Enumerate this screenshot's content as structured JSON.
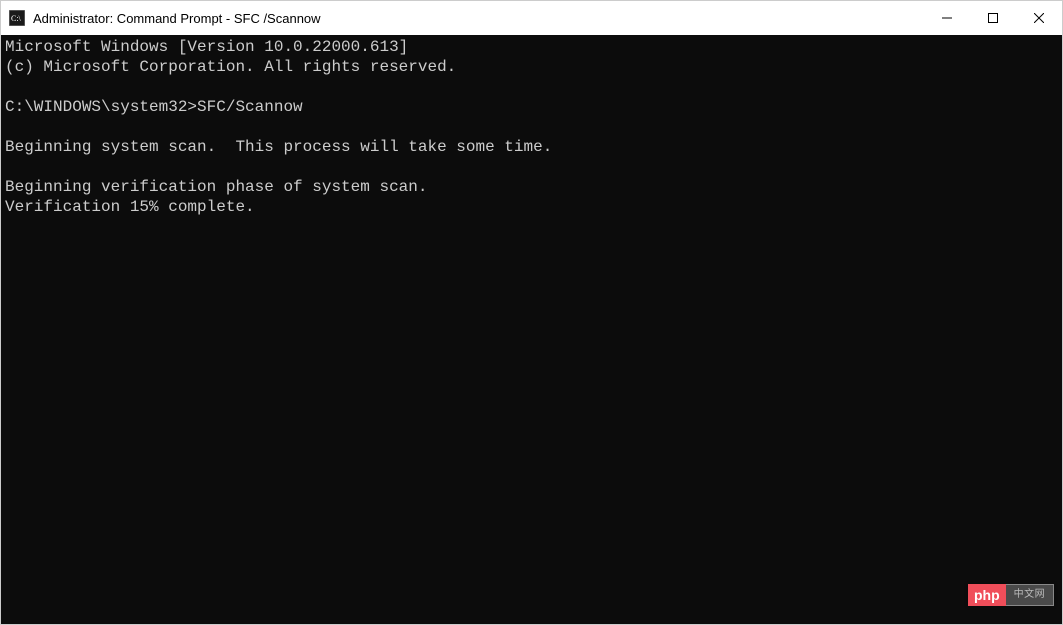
{
  "window": {
    "title": "Administrator: Command Prompt - SFC /Scannow"
  },
  "terminal": {
    "line1": "Microsoft Windows [Version 10.0.22000.613]",
    "line2": "(c) Microsoft Corporation. All rights reserved.",
    "blank1": "",
    "prompt": "C:\\WINDOWS\\system32>",
    "command": "SFC/Scannow",
    "blank2": "",
    "line3": "Beginning system scan.  This process will take some time.",
    "blank3": "",
    "line4": "Beginning verification phase of system scan.",
    "line5": "Verification 15% complete."
  },
  "watermark": {
    "left": "php",
    "right": "中文网"
  }
}
